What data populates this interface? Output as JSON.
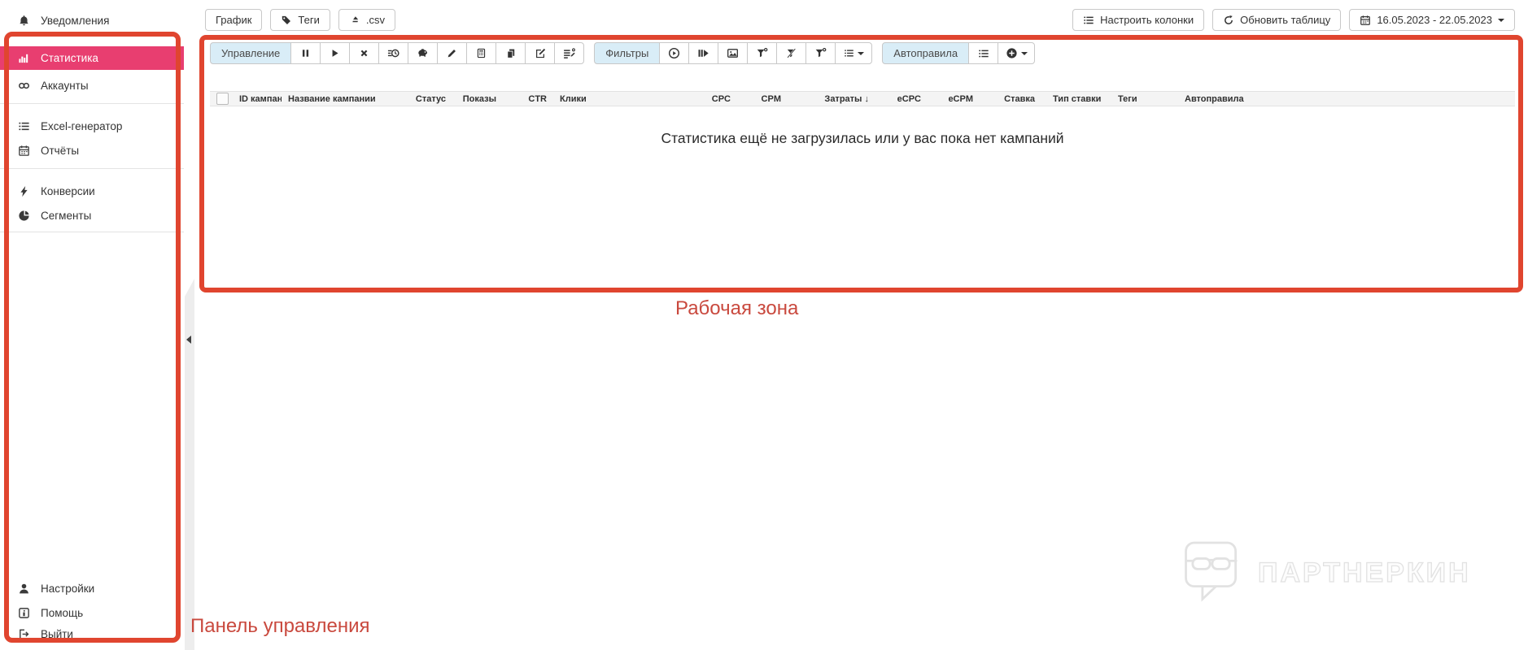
{
  "sidebar": {
    "items": [
      {
        "label": "Уведомления",
        "icon": "bell-icon"
      },
      {
        "label": "Статистика",
        "icon": "bar-chart-icon",
        "active": true
      },
      {
        "label": "Аккаунты",
        "icon": "link-icon"
      },
      {
        "label": "Excel-генератор",
        "icon": "list-icon"
      },
      {
        "label": "Отчёты",
        "icon": "calendar-icon"
      },
      {
        "label": "Конверсии",
        "icon": "lightning-icon"
      },
      {
        "label": "Сегменты",
        "icon": "pie-icon"
      },
      {
        "label": "Настройки",
        "icon": "user-icon"
      },
      {
        "label": "Помощь",
        "icon": "info-icon"
      },
      {
        "label": "Выйти",
        "icon": "logout-icon"
      }
    ]
  },
  "top_bar": {
    "chart_button": "График",
    "tags_button": "Теги",
    "csv_button": ".csv",
    "columns_button": "Настроить колонки",
    "refresh_button": "Обновить таблицу",
    "date_range": "16.05.2023 - 22.05.2023"
  },
  "toolbar": {
    "management_label": "Управление",
    "filters_label": "Фильтры",
    "autorules_label": "Автоправила"
  },
  "table": {
    "columns": [
      "ID кампан",
      "Название кампании",
      "Статус",
      "Показы",
      "CTR",
      "Клики",
      "CPC",
      "CPM",
      "Затраты ↓",
      "eCPC",
      "eCPM",
      "Ставка",
      "Тип ставки",
      "Теги",
      "Автоправила"
    ],
    "empty_message": "Статистика ещё не загрузилась или у вас пока нет кампаний"
  },
  "annotations": {
    "work_area": "Рабочая зона",
    "control_panel": "Панель управления"
  },
  "watermark": {
    "text": "ПАРТНЕРКИН"
  },
  "colors": {
    "accent_pink": "#e83e70",
    "annotation_border": "#e0452f",
    "annotation_text": "#c9493e",
    "group_label_bg": "#d9edf7"
  },
  "icons": {
    "bell-icon": "bell shape",
    "bar-chart-icon": "vertical bars",
    "link-icon": "two rings",
    "list-icon": "bulleted lines",
    "calendar-icon": "calendar grid",
    "lightning-icon": "bolt",
    "pie-icon": "pie chart",
    "user-icon": "person",
    "info-icon": "boxed i",
    "logout-icon": "door arrow",
    "tag-icon": "price tag",
    "export-csv-icon": "eject triangle",
    "refresh-icon": "circular arrow",
    "pause-icon": "two bars",
    "play-icon": "triangle",
    "close-x-icon": "bold cross",
    "history-icon": "clock with lines",
    "piggy-bank-icon": "pig",
    "pencil-icon": "pencil",
    "table-icon": "boxed grid",
    "copy-icon": "two sheets",
    "edit-square-icon": "box with pencil",
    "list-edit-icon": "lines with pencil",
    "play-circle-icon": "circled triangle",
    "step-forward-icon": "bars and triangle",
    "image-icon": "picture frame",
    "funnel-add-icon": "funnel with dot",
    "funnel-clear-icon": "funnel with slash",
    "chevron-down-icon": "caret",
    "plus-circle-icon": "circled plus"
  }
}
